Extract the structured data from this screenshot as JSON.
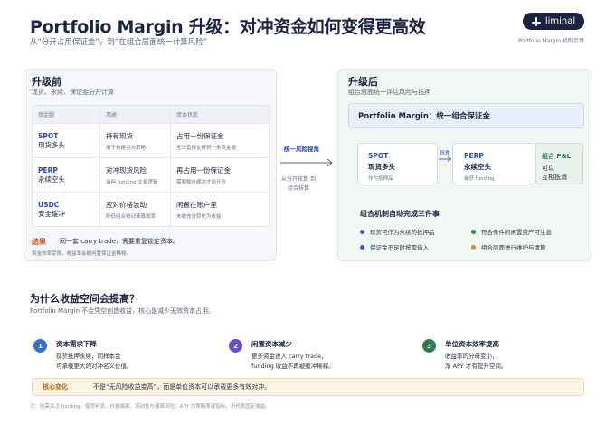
{
  "header": {
    "title": "Portfolio Margin 升级：对冲资金如何变得更高效",
    "subtitle": "从“分开占用保证金”，到“在组合层面统一计算风险”",
    "logo_text": "liminal",
    "logo_caption": "Portfolio Margin 机制示意"
  },
  "before": {
    "title": "升级前",
    "subtitle": "现货、永续、保证金分开计算",
    "columns": [
      "资金腿",
      "用途",
      "资本状态"
    ],
    "rows": [
      {
        "code": "SPOT",
        "name": "现货多头",
        "use": "持有现货",
        "use_sub": "用于构建对冲策略",
        "status": "占用一份保证金",
        "status_sub": "无法直接支持另一条资金腿"
      },
      {
        "code": "PERP",
        "name": "永续空头",
        "use": "对冲现货风险",
        "use_sub": "承担 funding 交易逻辑",
        "status": "再占用一份保证金",
        "status_sub": "需要额外缓冲才能开仓"
      },
      {
        "code": "USDC",
        "name": "安全缓冲",
        "use": "应对价格波动",
        "use_sub": "降低组合被动清算概率",
        "status": "闲置在账户里",
        "status_sub": "未被充分转化为收益"
      }
    ],
    "conclusion_label": "结果",
    "conclusion_text": "同一套 carry trade，需要重复锁定资本。",
    "conclusion_sub": "资金效率受限，收益率会被闲置保证金稀释。"
  },
  "middle": {
    "label": "统一风险视角",
    "sub": "从分开核算 到组合核算"
  },
  "after": {
    "title": "升级后",
    "subtitle": "组合层面统一评估风险与抵押",
    "pm_label": "Portfolio Margin：统一组合保证金",
    "spot": {
      "code": "SPOT",
      "name": "现货多头",
      "sub": "作为抵押品"
    },
    "link_label": "抵押",
    "perp": {
      "code": "PERP",
      "name": "永续空头",
      "sub": "捕获 funding"
    },
    "combo": {
      "code": "组合 P&L",
      "line1": "可以",
      "line2": "互相抵消"
    },
    "mechanism_title": "组合机制自动完成三件事",
    "bullets": [
      {
        "text": "现货可作为永续的抵押品",
        "color": "#3a5bd9"
      },
      {
        "text": "符合条件的闲置资产可生息",
        "color": "#2f8a5a"
      },
      {
        "text": "保证金不足时按需借入",
        "color": "#3a5bd9"
      },
      {
        "text": "组合层面进行维护与清算",
        "color": "#e08a2a"
      }
    ]
  },
  "why": {
    "title": "为什么收益空间会提高？",
    "subtitle": "Portfolio Margin 不会凭空创造收益，核心是减少无效资本占用。",
    "steps": [
      {
        "num": "1",
        "color": "#3a6fd8",
        "title": "资本需求下降",
        "line1": "现货抵押永续，同样本金",
        "line2": "可承载更大的对冲名义价值。"
      },
      {
        "num": "2",
        "color": "#6a4ccf",
        "title": "闲置资本减少",
        "line1": "更多资金进入 carry trade，",
        "line2": "funding 收益不再被缓冲稀释。"
      },
      {
        "num": "3",
        "color": "#2f7a55",
        "title": "单位资本效率提高",
        "line1": "收益率的分母变小，",
        "line2": "净 APY 才有提升空间。"
      }
    ]
  },
  "core": {
    "label": "核心变化",
    "text": "不是“无风险收益变高”，而是单位资本可以承载更多有效对冲。"
  },
  "footnote": "注：仍需关注 funding、借贷利息、价格偏离、流动性与清算风险；APY 为策略表现指标，不代表固定收益。"
}
